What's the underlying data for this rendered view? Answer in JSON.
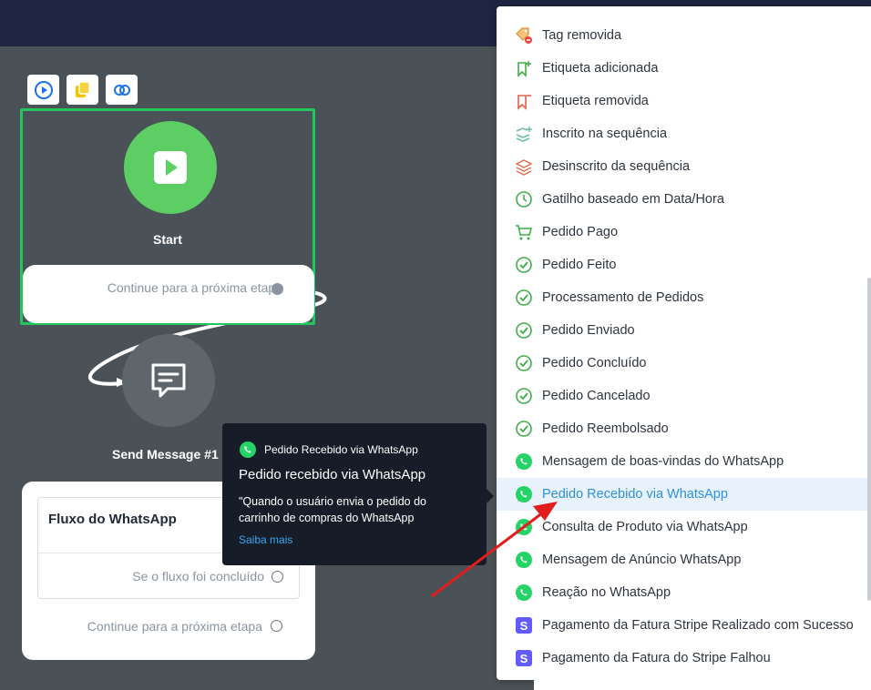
{
  "toolbar": {
    "buttons": [
      {
        "name": "play-button",
        "icon": "play-circle-icon",
        "color": "#1a73e8"
      },
      {
        "name": "duplicate-button",
        "icon": "copy-icon",
        "color": "#f5c400"
      },
      {
        "name": "link-button",
        "icon": "link-icon",
        "color": "#1a73e8"
      }
    ]
  },
  "start_node": {
    "title": "Start",
    "continue_text": "Continue para a próxima etapa",
    "color": "#5dce63"
  },
  "message_node": {
    "title": "Send Message #1"
  },
  "flow_card": {
    "title": "Fluxo do WhatsApp",
    "completed_text": "Se o fluxo foi concluído",
    "continue_text": "Continue para a próxima etapa"
  },
  "tooltip": {
    "header": "Pedido Recebido via WhatsApp",
    "title": "Pedido recebido via WhatsApp",
    "description": "\"Quando o usuário envia o pedido do carrinho de compras do WhatsApp",
    "link": "Saiba mais"
  },
  "menu": {
    "items": [
      {
        "label": "Tag removida",
        "icon": "tag-remove-icon"
      },
      {
        "label": "Etiqueta adicionada",
        "icon": "bookmark-add-icon"
      },
      {
        "label": "Etiqueta removida",
        "icon": "bookmark-remove-icon"
      },
      {
        "label": "Inscrito na sequência",
        "icon": "layers-add-icon"
      },
      {
        "label": "Desinscrito da sequência",
        "icon": "layers-remove-icon"
      },
      {
        "label": "Gatilho baseado em Data/Hora",
        "icon": "clock-icon"
      },
      {
        "label": "Pedido Pago",
        "icon": "cart-icon"
      },
      {
        "label": "Pedido Feito",
        "icon": "check-circle-icon"
      },
      {
        "label": "Processamento de Pedidos",
        "icon": "check-circle-icon"
      },
      {
        "label": "Pedido Enviado",
        "icon": "check-circle-icon"
      },
      {
        "label": "Pedido Concluído",
        "icon": "check-circle-icon"
      },
      {
        "label": "Pedido Cancelado",
        "icon": "check-circle-icon"
      },
      {
        "label": "Pedido Reembolsado",
        "icon": "check-circle-icon"
      },
      {
        "label": "Mensagem de boas-vindas do WhatsApp",
        "icon": "whatsapp-icon"
      },
      {
        "label": "Pedido Recebido via WhatsApp",
        "icon": "whatsapp-icon",
        "active": true
      },
      {
        "label": "Consulta de Produto via WhatsApp",
        "icon": "whatsapp-icon"
      },
      {
        "label": "Mensagem de Anúncio WhatsApp",
        "icon": "whatsapp-icon"
      },
      {
        "label": "Reação no WhatsApp",
        "icon": "whatsapp-icon"
      },
      {
        "label": "Pagamento da Fatura Stripe Realizado com Sucesso",
        "icon": "stripe-icon"
      },
      {
        "label": "Pagamento da Fatura do Stripe Falhou",
        "icon": "stripe-icon"
      }
    ]
  },
  "colors": {
    "canvas": "#4b5257",
    "topbar": "#1d2541",
    "selection_border": "#22c55e",
    "whatsapp": "#25d366",
    "check": "#3fae49",
    "active_text": "#2f8fdd",
    "active_bg": "#e7f2fc",
    "annotation_arrow": "#e11d1d"
  }
}
